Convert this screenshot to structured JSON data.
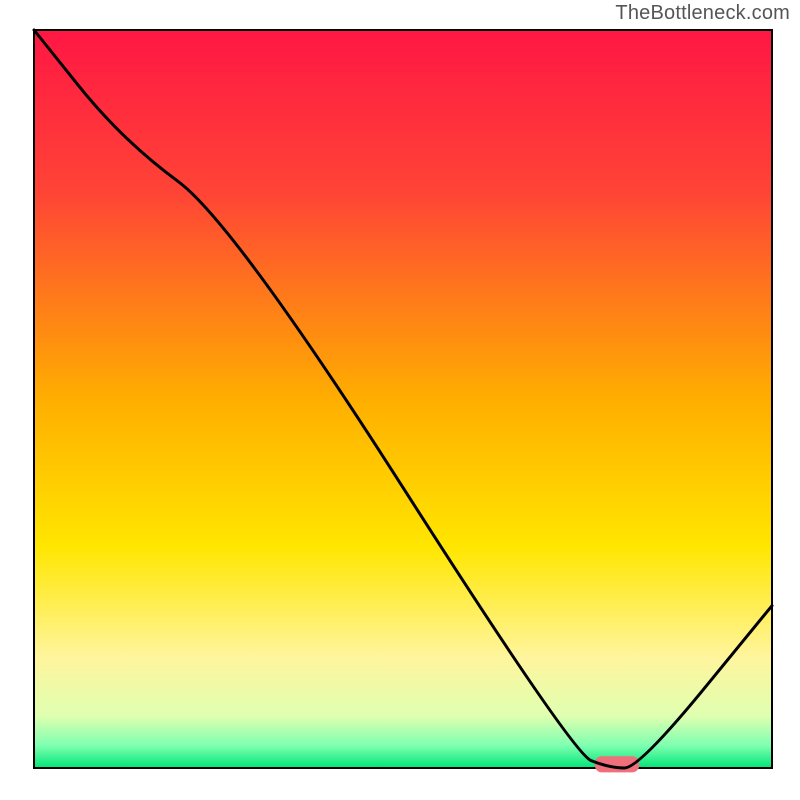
{
  "watermark": "TheBottleneck.com",
  "chart_data": {
    "type": "line",
    "title": "",
    "xlabel": "",
    "ylabel": "",
    "xlim": [
      0,
      100
    ],
    "ylim": [
      0,
      100
    ],
    "legend": false,
    "grid": false,
    "background_gradient": {
      "stops": [
        {
          "offset": 0.0,
          "color": "#ff1744"
        },
        {
          "offset": 0.22,
          "color": "#ff4436"
        },
        {
          "offset": 0.5,
          "color": "#ffae00"
        },
        {
          "offset": 0.7,
          "color": "#ffe600"
        },
        {
          "offset": 0.85,
          "color": "#fff59d"
        },
        {
          "offset": 0.93,
          "color": "#dfffb0"
        },
        {
          "offset": 0.97,
          "color": "#7dffb0"
        },
        {
          "offset": 1.0,
          "color": "#00e676"
        }
      ]
    },
    "series": [
      {
        "name": "bottleneck-curve",
        "color": "#000000",
        "x": [
          0,
          12,
          27,
          73,
          78,
          82,
          100
        ],
        "values": [
          100,
          85,
          74,
          2,
          0,
          0,
          22
        ]
      }
    ],
    "marker": {
      "name": "optimal-range",
      "color": "#ef6f7a",
      "x_start": 76,
      "x_end": 82,
      "y": 0.5,
      "thickness": 2.2
    }
  }
}
